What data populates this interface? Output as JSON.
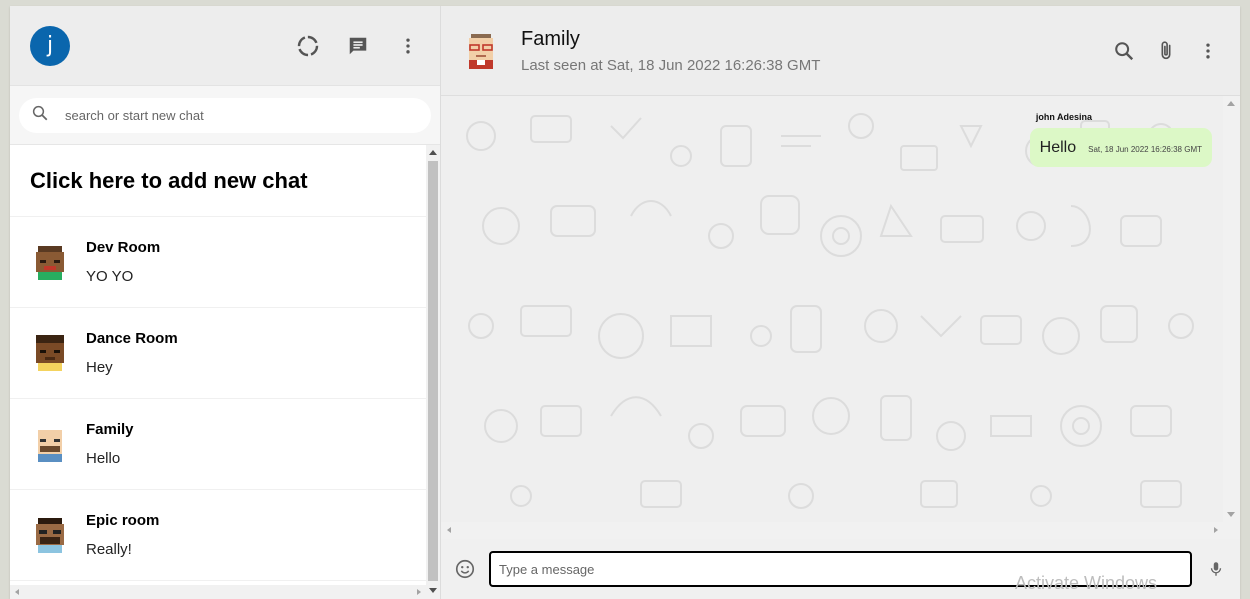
{
  "sidebar": {
    "user_initial": "j",
    "search_placeholder": "search or start new chat",
    "add_new_chat": "Click here to add new chat",
    "rooms": [
      {
        "name": "Dev Room",
        "last_message": "YO YO",
        "avatar": "pixel-avatar-dev"
      },
      {
        "name": "Dance Room",
        "last_message": "Hey",
        "avatar": "pixel-avatar-dance"
      },
      {
        "name": "Family",
        "last_message": "Hello",
        "avatar": "pixel-avatar-family"
      },
      {
        "name": "Epic room",
        "last_message": "Really!",
        "avatar": "pixel-avatar-epic"
      }
    ]
  },
  "chat": {
    "title": "Family",
    "last_seen": "Last seen at Sat, 18 Jun 2022 16:26:38 GMT",
    "messages": [
      {
        "author": "john Adesina",
        "text": "Hello",
        "time": "Sat, 18 Jun 2022 16:26:38 GMT"
      }
    ],
    "input_placeholder": "Type a message"
  },
  "icons": {
    "status": "status-ring-icon",
    "new_chat": "chat-bubble-icon",
    "menu": "more-vert-icon",
    "search": "search-icon",
    "attach": "paperclip-icon",
    "emoji": "emoji-icon",
    "mic": "mic-icon"
  },
  "colors": {
    "avatar_bg": "#0a66ad",
    "bubble_bg": "#dcf8c6"
  },
  "watermark": "Activate Windows"
}
